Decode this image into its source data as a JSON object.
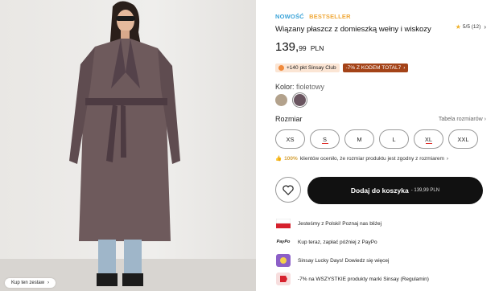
{
  "product": {
    "badge_new": "NOWOŚĆ",
    "badge_bestseller": "BESTSELLER",
    "rating_text": "5/5 (12)",
    "title": "Wiązany płaszcz z domieszką wełny i wiskozy",
    "price_main": "139,",
    "price_cents": "99",
    "price_currency": "PLN"
  },
  "promos": {
    "club_text": "+140 pkt Sinsay Club",
    "code_text": "-7% Z KODEM TOTAL7"
  },
  "color": {
    "label": "Kolor:",
    "value": "fioletowy",
    "swatches": [
      "#b3a28c",
      "#6a5560"
    ]
  },
  "size": {
    "label": "Rozmiar",
    "table_link": "Tabela rozmiarów",
    "options": [
      "XS",
      "S",
      "M",
      "L",
      "XL",
      "XXL"
    ]
  },
  "fit_note": {
    "percent": "100%",
    "text": "klientów oceniło, że rozmiar produktu jest zgodny z rozmiarem"
  },
  "cart": {
    "label": "Dodaj do koszyka",
    "price": "- 139,99 PLN"
  },
  "perks": [
    {
      "icon": "polish-flag-icon",
      "text": "Jesteśmy z Polski! Poznaj nas bliżej"
    },
    {
      "icon": "paypo-icon",
      "text": "Kup teraz, zapłać później z PayPo",
      "icon_text": "PayPo"
    },
    {
      "icon": "lucky-days-icon",
      "text": "Sinsay Lucky Days! Dowiedz się więcej"
    },
    {
      "icon": "discount-tag-icon",
      "text": "-7% na WSZYSTKIE produkty marki Sinsay (Regulamin)"
    }
  ],
  "photo": {
    "shop_look": "Kup ten zestaw"
  },
  "colors": {
    "new_badge": "#3aa3d8",
    "bestseller_badge": "#f0a93a",
    "code_promo": "#a44318",
    "cart_button": "#111111"
  }
}
